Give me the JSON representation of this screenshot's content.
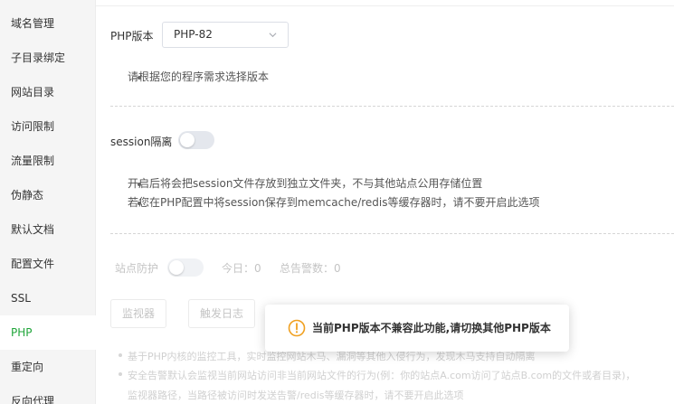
{
  "sidebar": {
    "items": [
      {
        "label": "域名管理"
      },
      {
        "label": "子目录绑定"
      },
      {
        "label": "网站目录"
      },
      {
        "label": "访问限制"
      },
      {
        "label": "流量限制"
      },
      {
        "label": "伪静态"
      },
      {
        "label": "默认文档"
      },
      {
        "label": "配置文件"
      },
      {
        "label": "SSL"
      },
      {
        "label": "PHP",
        "active": true
      },
      {
        "label": "重定向"
      },
      {
        "label": "反向代理"
      }
    ]
  },
  "php": {
    "label": "PHP版本",
    "selected": "PHP-82",
    "tip": "请根据您的程序需求选择版本"
  },
  "session": {
    "label": "session隔离",
    "enabled": false,
    "tips": [
      "开启后将会把session文件存放到独立文件夹，不与其他站点公用存储位置",
      "若您在PHP配置中将session保存到memcache/redis等缓存器时，请不要开启此选项"
    ]
  },
  "protection": {
    "label": "站点防护",
    "enabled": false,
    "today_label": "今日：",
    "today_value": "0",
    "total_label": "总告警数：",
    "total_value": "0",
    "monitor_button": "监视器",
    "log_button": "触发日志",
    "tips": [
      "基于PHP内核的监控工具，实时监控网站木马、漏洞等其他入侵行为，发现木马支持自动隔离",
      "安全告警默认会监视当前网站访问非当前网站文件的行为(例：你的站点A.com访问了站点B.com的文件或者目录)，",
      "监视器路径，当路径被访问时发送告警/redis等缓存器时，请不要开启此选项"
    ]
  },
  "toast": {
    "icon": "warning-circle-icon",
    "message": "当前PHP版本不兼容此功能,请切换其他PHP版本",
    "color": "#f0a020"
  },
  "colors": {
    "accent": "#20a53a"
  }
}
